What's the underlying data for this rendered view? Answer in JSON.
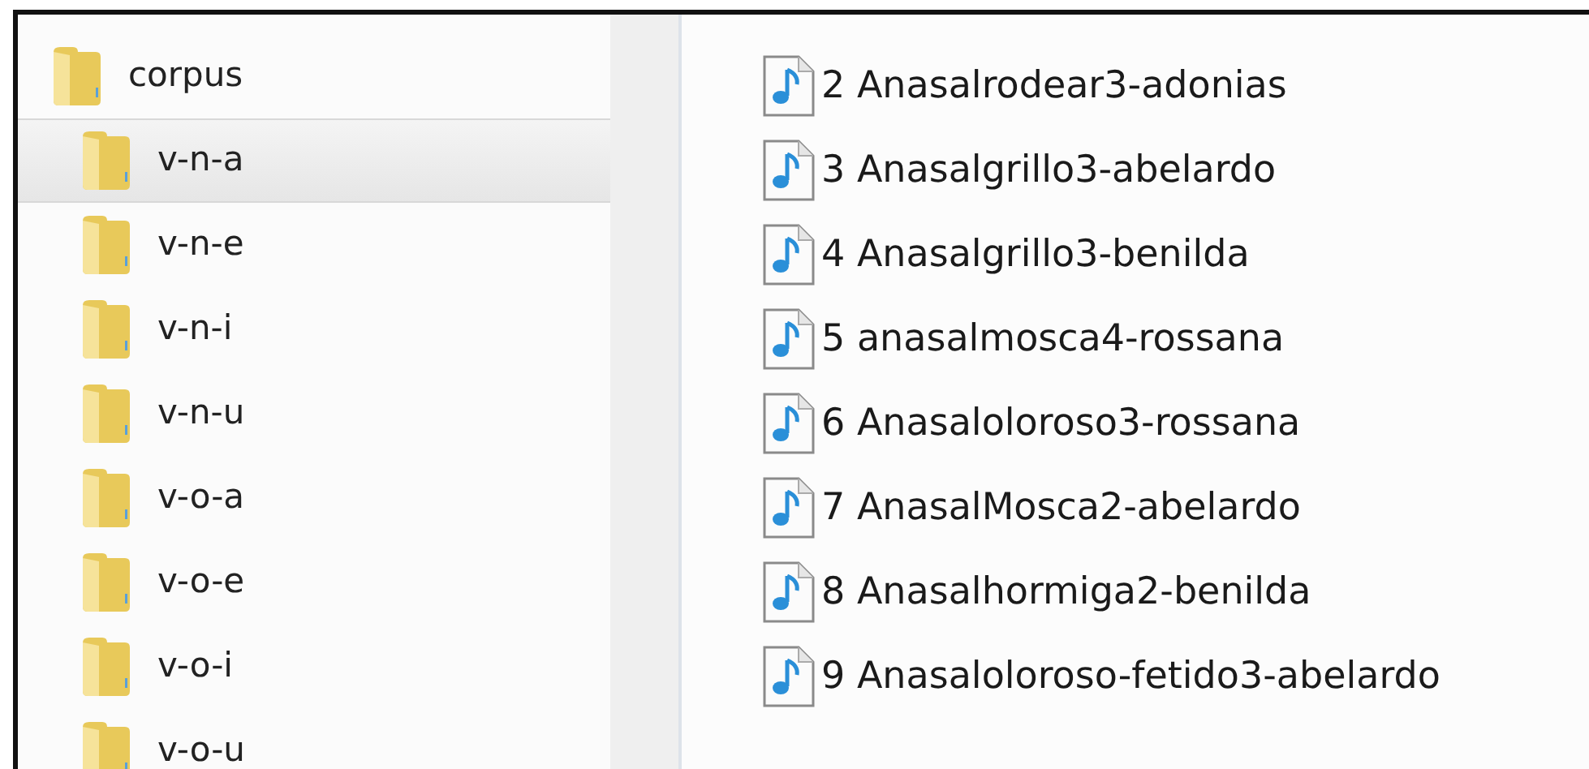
{
  "folder_tree": [
    {
      "label": "corpus",
      "selected": false,
      "children": [
        {
          "label": "v-n-a",
          "selected": true
        },
        {
          "label": "v-n-e",
          "selected": false
        },
        {
          "label": "v-n-i",
          "selected": false
        },
        {
          "label": "v-n-u",
          "selected": false
        },
        {
          "label": "v-o-a",
          "selected": false
        },
        {
          "label": "v-o-e",
          "selected": false
        },
        {
          "label": "v-o-i",
          "selected": false
        },
        {
          "label": "v-o-u",
          "selected": false
        }
      ]
    }
  ],
  "files": [
    {
      "name": "2 Anasalrodear3-adonias"
    },
    {
      "name": "3 Anasalgrillo3-abelardo"
    },
    {
      "name": "4 Anasalgrillo3-benilda"
    },
    {
      "name": "5 anasalmosca4-rossana"
    },
    {
      "name": "6 Anasaloloroso3-rossana"
    },
    {
      "name": "7 AnasalMosca2-abelardo"
    },
    {
      "name": "8 Anasalhormiga2-benilda"
    },
    {
      "name": "9 Anasaloloroso-fetido3-abelardo"
    }
  ]
}
